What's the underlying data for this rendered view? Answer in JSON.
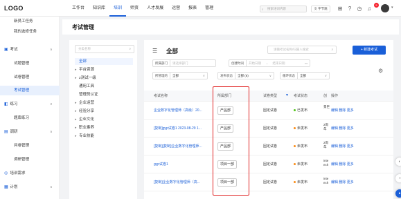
{
  "topbar": {
    "logo": "LOGO",
    "nav": [
      "工作台",
      "知识库",
      "培训",
      "师资",
      "人才发展",
      "运营",
      "报表",
      "管理"
    ],
    "active_nav": "培训",
    "search_placeholder": "搜索培训内容",
    "translate_label": "字节跳",
    "icons": [
      "grid-icon",
      "help-icon",
      "clock-icon",
      "bell-icon"
    ],
    "badge": "5"
  },
  "sidebar": {
    "items": [
      {
        "label": "新员工任务",
        "kind": "sub"
      },
      {
        "label": "我的选修任务",
        "kind": "sub"
      },
      {
        "label": "考试",
        "kind": "group",
        "icon": "exam-icon",
        "open": true
      },
      {
        "label": "试题管理",
        "kind": "sub"
      },
      {
        "label": "试卷管理",
        "kind": "sub"
      },
      {
        "label": "考试管理",
        "kind": "sub",
        "active": true
      },
      {
        "label": "练习",
        "kind": "group",
        "icon": "practice-icon",
        "open": false
      },
      {
        "label": "题库练习",
        "kind": "sub"
      },
      {
        "label": "调研",
        "kind": "group",
        "icon": "survey-icon",
        "open": true
      },
      {
        "label": "问卷管理",
        "kind": "sub"
      },
      {
        "label": "调研管理",
        "kind": "sub"
      },
      {
        "label": "培训需求",
        "kind": "group",
        "icon": "demand-icon"
      },
      {
        "label": "计划",
        "kind": "group",
        "icon": "plan-icon",
        "open": true
      }
    ]
  },
  "header": {
    "title": "考试管理"
  },
  "tree": {
    "search_placeholder": "分类名称",
    "items": [
      {
        "label": "全部",
        "selected": true,
        "caret": false
      },
      {
        "label": "平台资源",
        "caret": true
      },
      {
        "label": "z测试一级",
        "caret": true
      },
      {
        "label": "通用工具",
        "caret": false
      },
      {
        "label": "管理员认证",
        "caret": false
      },
      {
        "label": "企业运营",
        "caret": true
      },
      {
        "label": "经验分享",
        "caret": true
      },
      {
        "label": "企业文化",
        "caret": true
      },
      {
        "label": "职业素养",
        "caret": true
      },
      {
        "label": "专业技能",
        "caret": true
      }
    ]
  },
  "main": {
    "title": "全部",
    "search_placeholder": "请输考试名称/归属人搜索",
    "new_button": "+ 新建考试",
    "filters": {
      "dept_label": "所属部门",
      "dept_placeholder": "请选择部门",
      "date_label": "创建时间",
      "date_start": "开始日期",
      "date_sep": "→",
      "date_end": "结束日期",
      "manage_label": "所管理的",
      "manage_value": "全部",
      "publish_label": "发布状态",
      "publish_value": "全部 (6)",
      "cycle_label": "循环状态",
      "cycle_value": "全部"
    },
    "columns": [
      "考试名称",
      "所属部门",
      "试卷类型",
      "考试状态",
      "创",
      "操作"
    ],
    "rows": [
      {
        "name": "企业数字化管理师（高级）20...",
        "dept": "产品部",
        "type": "固定试卷",
        "status": "已发布",
        "status_color": "#52c41a",
        "created": "景巨",
        "ops": "编辑 删除 更多"
      },
      {
        "name": "[复制]gyp试卷1 2023-08-29 1...",
        "dept": "产品部",
        "type": "固定试卷",
        "status": "未发布",
        "status_color": "#fa8c16",
        "created": "2周 年",
        "ops": "编辑 删除 更多"
      },
      {
        "name": "[复制][复制]企业数字化管理师...",
        "dept": "产品部",
        "type": "固定试卷",
        "status": "未发布",
        "status_color": "#fa8c16",
        "created": "2周 年",
        "ops": "编辑 删除 更多"
      },
      {
        "name": "gyp试卷1",
        "dept": "项目一部",
        "type": "固定试卷",
        "status": "未发布",
        "status_color": "#fa8c16",
        "created": "inte ech",
        "ops": "编辑 删除 更多"
      },
      {
        "name": "[复制]企业数字化管理师（高...",
        "dept": "项目一部",
        "type": "固定试卷",
        "status": "未发布",
        "status_color": "#fa8c16",
        "created": "inte ech",
        "ops": "编辑 删除 更多"
      }
    ]
  }
}
